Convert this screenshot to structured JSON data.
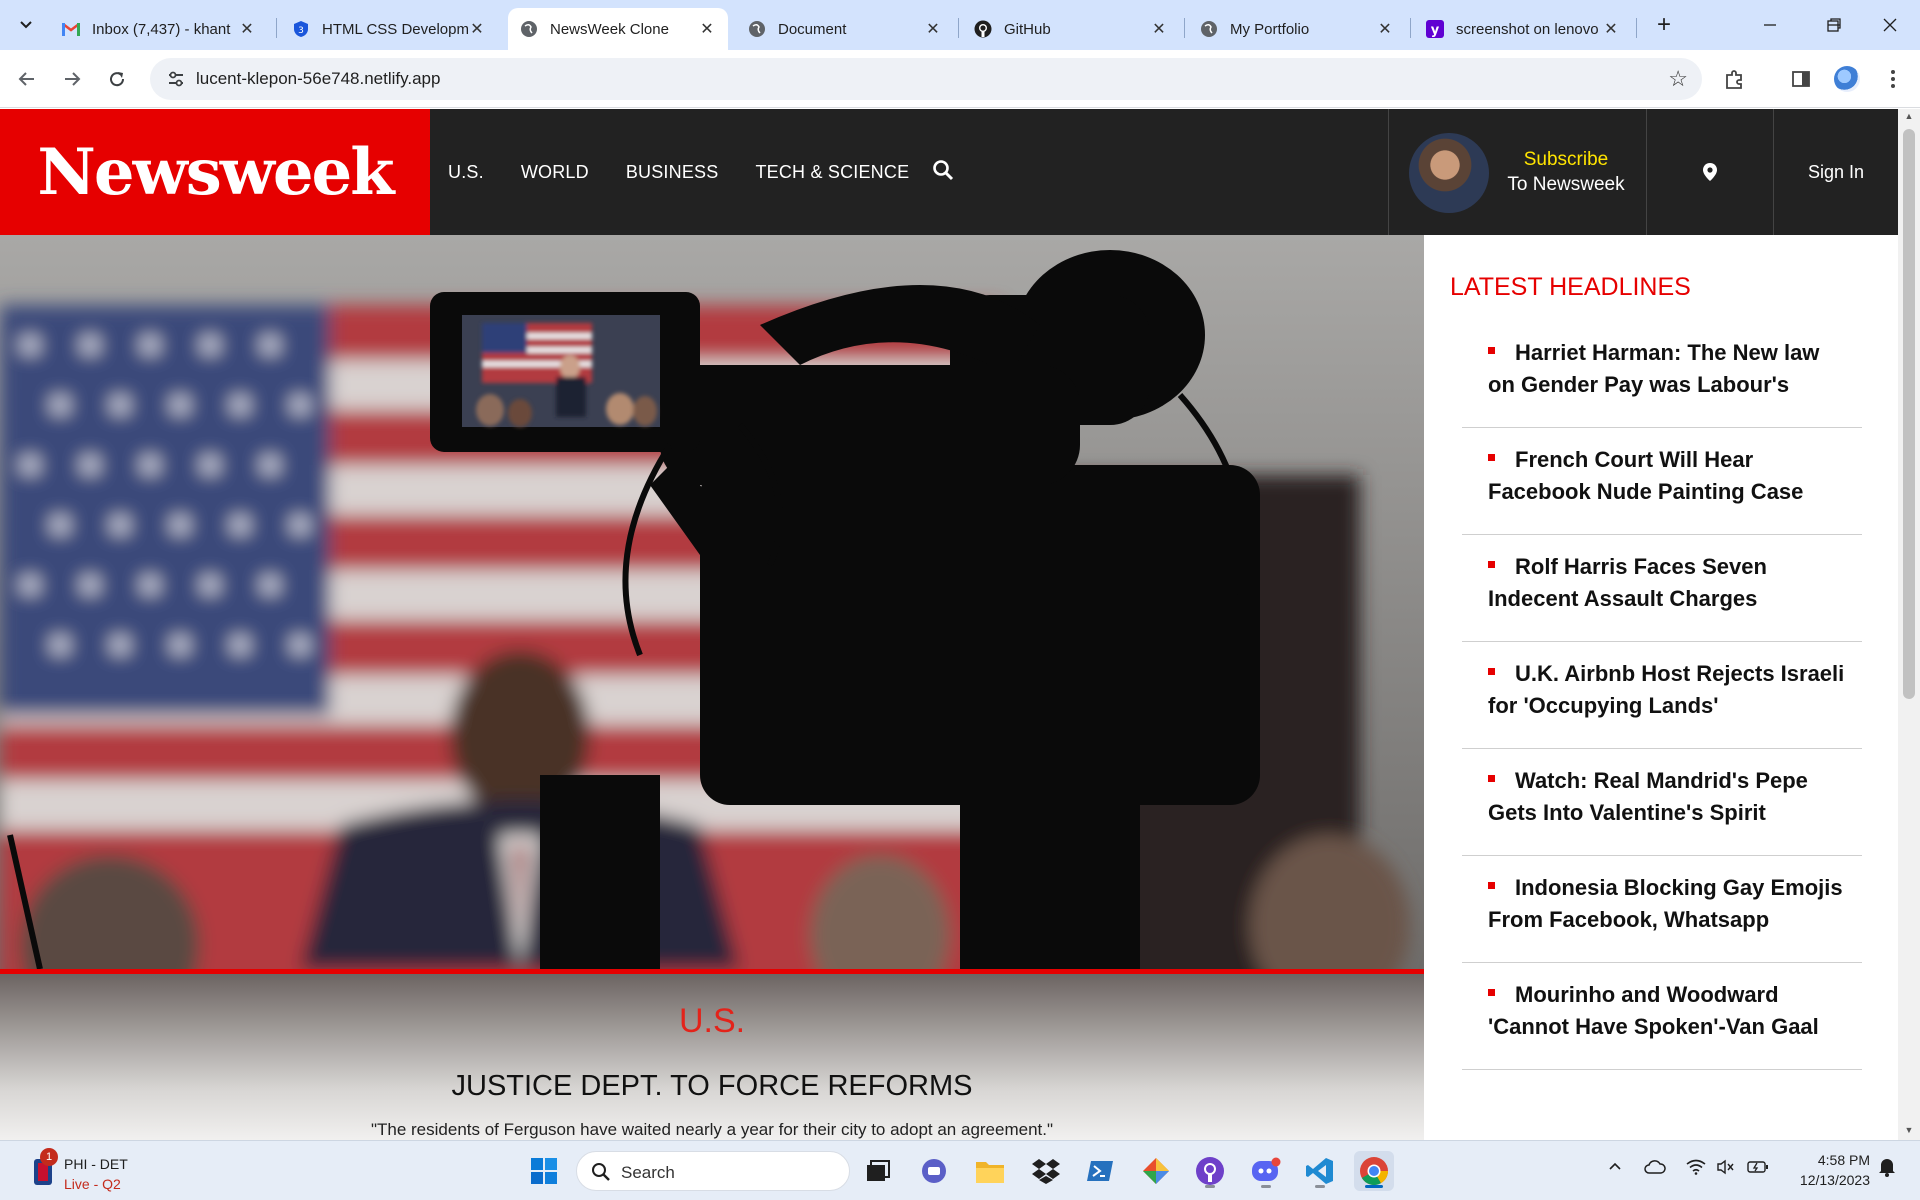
{
  "browser": {
    "tabs": [
      {
        "title": "Inbox (7,437) - khant",
        "icon": "gmail-icon",
        "active": false
      },
      {
        "title": "HTML CSS Developm",
        "icon": "shield-icon",
        "active": false
      },
      {
        "title": "NewsWeek Clone",
        "icon": "globe-icon",
        "active": true
      },
      {
        "title": "Document",
        "icon": "globe-icon",
        "active": false
      },
      {
        "title": "GitHub",
        "icon": "github-icon",
        "active": false
      },
      {
        "title": "My Portfolio",
        "icon": "globe-icon",
        "active": false
      },
      {
        "title": "screenshot on lenovo",
        "icon": "yahoo-icon",
        "active": false
      }
    ],
    "url": "lucent-klepon-56e748.netlify.app"
  },
  "site": {
    "logo": "Newsweek",
    "nav": [
      "U.S.",
      "WORLD",
      "BUSINESS",
      "TECH & SCIENCE"
    ],
    "subscribe_line1": "Subscribe",
    "subscribe_line2": "To Newsweek",
    "sign_in": "Sign In",
    "colors": {
      "brand_red": "#e60000",
      "header_bg": "#222222",
      "subscribe_yellow": "#ffe400"
    }
  },
  "hero": {
    "category": "U.S.",
    "title": "JUSTICE DEPT. TO FORCE REFORMS",
    "description": "\"The residents of Ferguson have waited nearly a year for their city to adopt an agreement.\""
  },
  "latest": {
    "heading": "LATEST HEADLINES",
    "items": [
      "Harriet Harman: The New law on Gender Pay was Labour's",
      "French Court Will Hear Facebook Nude Painting Case",
      "Rolf Harris Faces Seven Indecent Assault Charges",
      "U.K. Airbnb Host Rejects Israeli for 'Occupying Lands'",
      "Watch: Real Mandrid's Pepe Gets Into Valentine's Spirit",
      "Indonesia Blocking Gay Emojis From Facebook, Whatsapp",
      "Mourinho and Woodward 'Cannot Have Spoken'-Van Gaal"
    ]
  },
  "taskbar": {
    "widget_line1": "PHI - DET",
    "widget_line2": "Live - Q2",
    "widget_badge": "1",
    "search_placeholder": "Search",
    "time": "4:58 PM",
    "date": "12/13/2023"
  }
}
